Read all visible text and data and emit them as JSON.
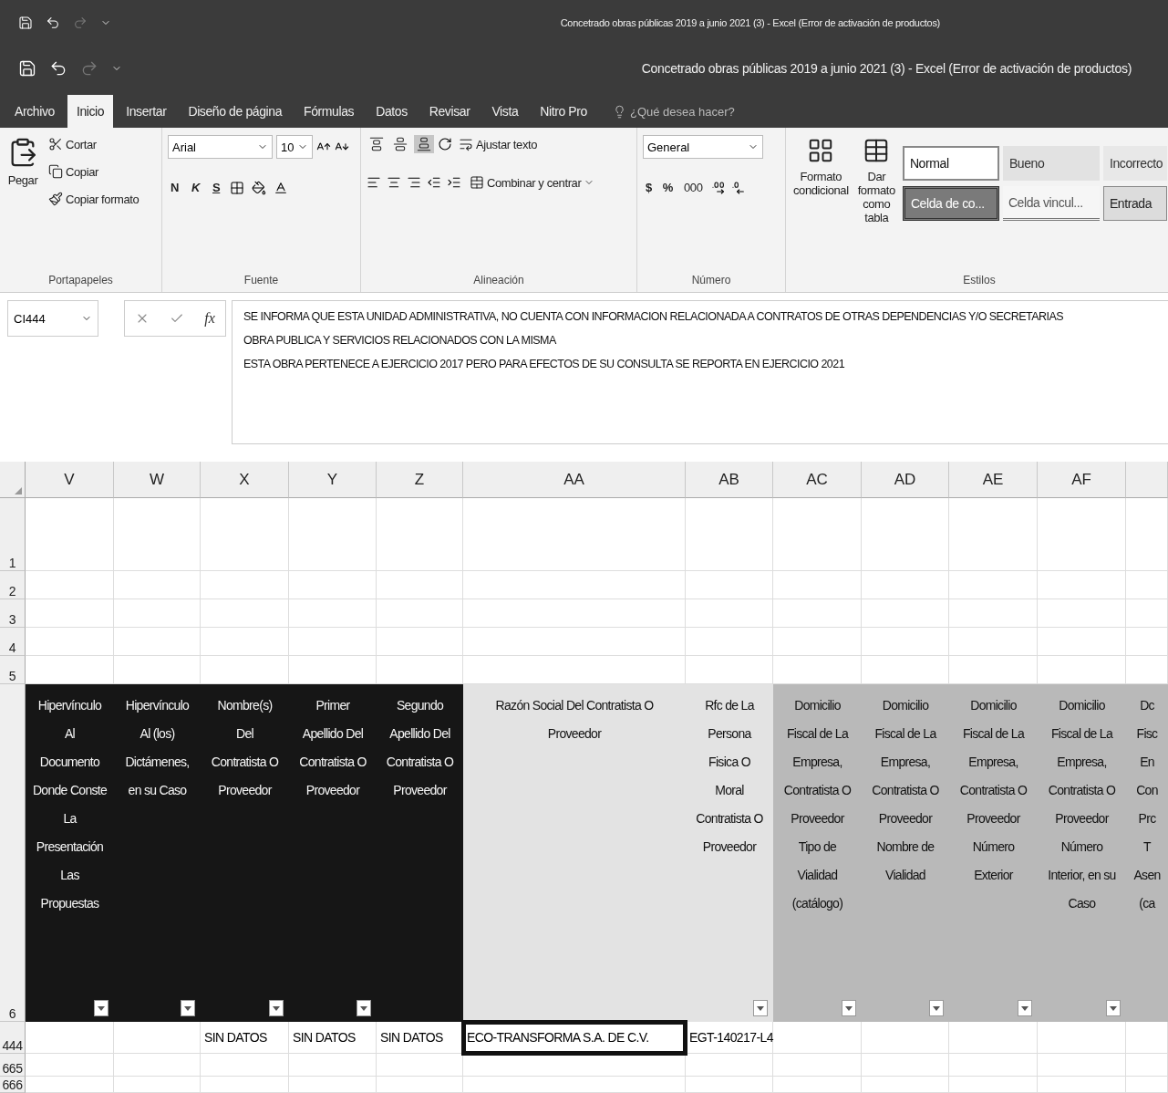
{
  "title_bar": {
    "rows": [
      {
        "title": "Concetrado obras públicas 2019 a junio 2021 (3) - Excel (Error de activación de productos)"
      },
      {
        "title": "Concetrado obras públicas 2019 a junio 2021 (3) - Excel (Error de activación de productos)"
      }
    ]
  },
  "menu_tabs": [
    {
      "label": "Archivo",
      "selected": false
    },
    {
      "label": "Inicio",
      "selected": true
    },
    {
      "label": "Insertar",
      "selected": false
    },
    {
      "label": "Diseño de página",
      "selected": false
    },
    {
      "label": "Fórmulas",
      "selected": false
    },
    {
      "label": "Datos",
      "selected": false
    },
    {
      "label": "Revisar",
      "selected": false
    },
    {
      "label": "Vista",
      "selected": false
    },
    {
      "label": "Nitro Pro",
      "selected": false
    }
  ],
  "tell_me": {
    "placeholder": "¿Qué desea hacer?"
  },
  "ribbon": {
    "clipboard": {
      "paste": "Pegar",
      "cut": "Cortar",
      "copy": "Copiar",
      "format_painter": "Copiar formato",
      "label": "Portapapeles"
    },
    "font": {
      "name": "Arial",
      "size": "10",
      "bold": "N",
      "italic": "K",
      "underline": "S",
      "label": "Fuente"
    },
    "alignment": {
      "vertical": [
        {
          "selected": false
        },
        {
          "selected": false
        },
        {
          "selected": true
        }
      ],
      "wrap": "Ajustar texto",
      "merge": "Combinar y centrar",
      "label": "Alineación"
    },
    "number": {
      "format": "General",
      "currency": "$",
      "percent": "%",
      "thousands": "000",
      "label": "Número"
    },
    "styles": {
      "conditional": "Formato condicional",
      "as_table": "Dar formato como tabla",
      "gallery": [
        {
          "label": "Normal",
          "kind": "normal"
        },
        {
          "label": "Bueno",
          "kind": "good"
        },
        {
          "label": "Incorrecto",
          "kind": "bad"
        },
        {
          "label": "Celda de co...",
          "kind": "check"
        },
        {
          "label": "Celda vincul...",
          "kind": "linked"
        },
        {
          "label": "Entrada",
          "kind": "input"
        }
      ],
      "label": "Estilos"
    }
  },
  "formula_bar": {
    "name_box": "CI444",
    "fx": "fx",
    "lines": [
      "SE INFORMA QUE ESTA UNIDAD ADMINISTRATIVA, NO CUENTA CON INFORMACION RELACIONADA A CONTRATOS DE OTRAS DEPENDENCIAS Y/O SECRETARIAS",
      "OBRA PUBLICA Y SERVICIOS RELACIONADOS CON LA MISMA",
      "ESTA OBRA PERTENECE A EJERCICIO 2017 PERO PARA EFECTOS DE SU CONSULTA SE REPORTA EN EJERCICIO 2021"
    ]
  },
  "columns": [
    {
      "letter": "V",
      "header": "Hipervínculo\nAl\nDocumento\nDonde Conste\nLa\nPresentación\nLas\nPropuestas",
      "kind": "dark",
      "filter": true
    },
    {
      "letter": "W",
      "header": "Hipervínculo\nAl (los)\nDictámenes,\nen su Caso",
      "kind": "dark",
      "filter": true
    },
    {
      "letter": "X",
      "header": "Nombre(s)\nDel\nContratista O\nProveedor",
      "kind": "dark",
      "filter": true
    },
    {
      "letter": "Y",
      "header": "Primer\nApellido Del\nContratista O\nProveedor",
      "kind": "dark",
      "filter": true
    },
    {
      "letter": "Z",
      "header": "Segundo\nApellido Del\nContratista O\nProveedor",
      "kind": "dark",
      "filter": false
    },
    {
      "letter": "AA",
      "header": "Razón Social Del Contratista O\nProveedor",
      "kind": "light",
      "filter": false
    },
    {
      "letter": "AB",
      "header": "Rfc de La\nPersona\nFisica O\nMoral\nContratista O\nProveedor",
      "kind": "light",
      "filter": true
    },
    {
      "letter": "AC",
      "header": "Domicilio\nFiscal de La\nEmpresa,\nContratista O\nProveedor\nTipo de\nVialidad\n(catálogo)",
      "kind": "mid",
      "filter": true
    },
    {
      "letter": "AD",
      "header": "Domicilio\nFiscal de La\nEmpresa,\nContratista O\nProveedor\nNombre de\nVialidad",
      "kind": "mid",
      "filter": true
    },
    {
      "letter": "AE",
      "header": "Domicilio\nFiscal de La\nEmpresa,\nContratista O\nProveedor\nNúmero\nExterior",
      "kind": "mid",
      "filter": true
    },
    {
      "letter": "AF",
      "header": "Domicilio\nFiscal de La\nEmpresa,\nContratista O\nProveedor\nNúmero\nInterior, en su\nCaso",
      "kind": "mid",
      "filter": true
    },
    {
      "header": "Dc\nFisc\nEn\nCon\nPrc\nT\nAsen\n(ca",
      "kind": "mid",
      "filter": false
    }
  ],
  "blank_rows": [
    "1",
    "2",
    "3",
    "4",
    "5"
  ],
  "header_row": "6",
  "data_rows": [
    {
      "number": "444",
      "cells": [
        {
          "selected": false
        },
        {
          "selected": false
        },
        {
          "text": "SIN DATOS",
          "selected": false
        },
        {
          "text": "SIN DATOS",
          "selected": false
        },
        {
          "text": "SIN DATOS",
          "selected": false
        },
        {
          "text": "ECO-TRANSFORMA S.A. DE C.V.",
          "selected": true
        },
        {
          "text": "EGT-140217-L4",
          "selected": false
        },
        {
          "selected": false
        },
        {
          "selected": false
        },
        {
          "selected": false
        },
        {
          "selected": false
        },
        {
          "selected": false
        }
      ]
    },
    {
      "number": "665",
      "cells": []
    },
    {
      "number": "666",
      "cells": []
    }
  ]
}
